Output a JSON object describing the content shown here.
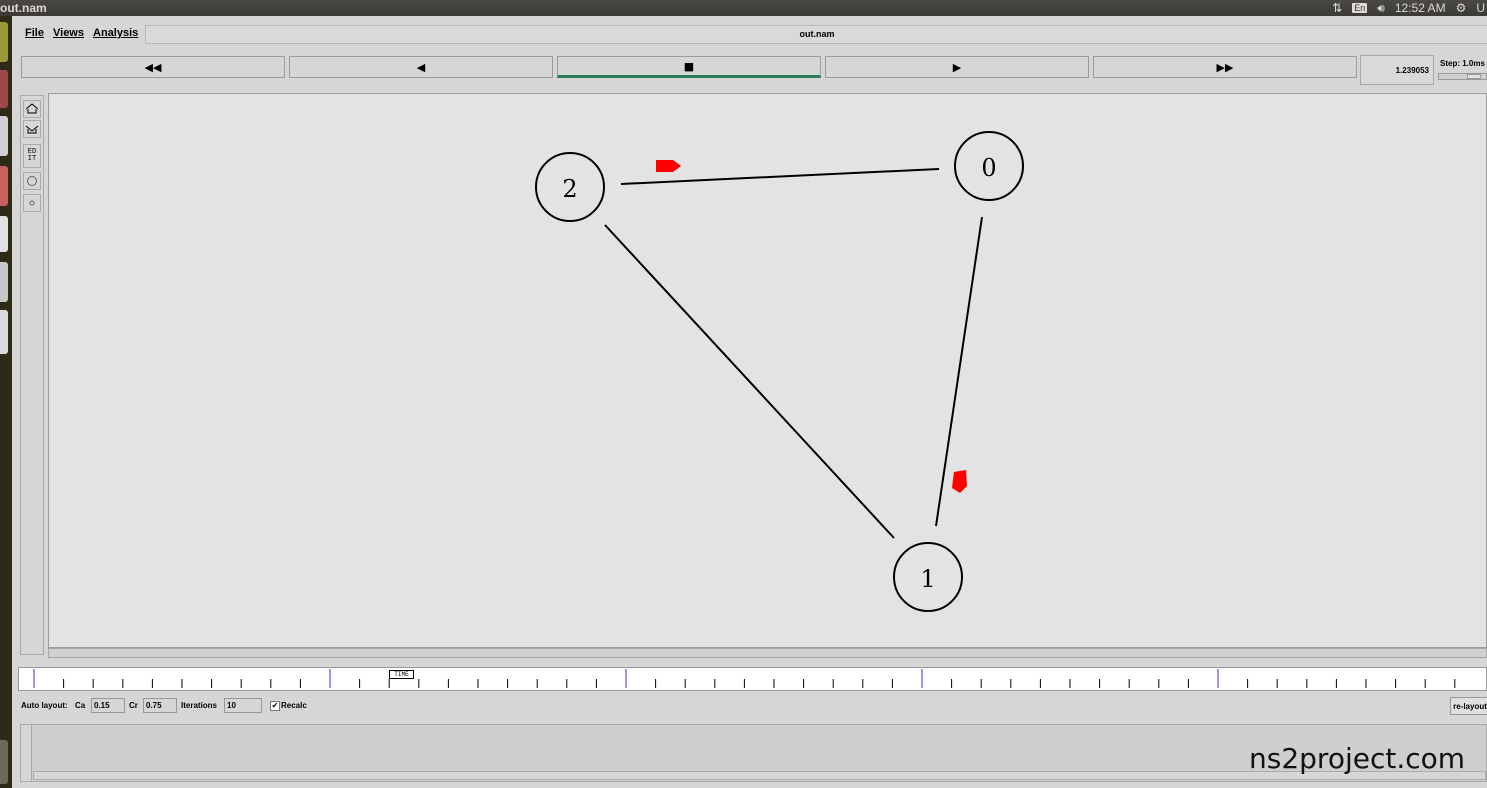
{
  "window": {
    "title": "out.nam"
  },
  "panel": {
    "lang": "En",
    "clock": "12:52 AM",
    "user_initial": "U"
  },
  "menus": [
    "File",
    "Views",
    "Analysis"
  ],
  "filename": "out.nam",
  "controls": {
    "rewind": "◀◀",
    "back": "◀",
    "stop": "■",
    "play": "▶",
    "fastforward": "▶▶"
  },
  "time_value": "1.239053",
  "step_label": "Step: 1.0ms",
  "toolbox": {
    "edit_label": "ED IT"
  },
  "topology": {
    "nodes": [
      {
        "id": "0",
        "label": "0"
      },
      {
        "id": "1",
        "label": "1"
      },
      {
        "id": "2",
        "label": "2"
      }
    ],
    "links": [
      [
        "2",
        "0"
      ],
      [
        "2",
        "1"
      ],
      [
        "0",
        "1"
      ]
    ]
  },
  "timeline": {
    "marker_label": "TIME"
  },
  "auto_layout": {
    "label": "Auto layout:",
    "ca_label": "Ca",
    "ca_value": "0.15",
    "cr_label": "Cr",
    "cr_value": "0.75",
    "iter_label": "Iterations",
    "iter_value": "10",
    "recalc_label": "Recalc",
    "recalc_checked": true,
    "relayout_label": "re-layout"
  },
  "watermark": "ns2project.com",
  "colors": {
    "packet": "#ff0000",
    "active_bar": "#2e7d5a",
    "timeline_major": "#3030d0"
  }
}
